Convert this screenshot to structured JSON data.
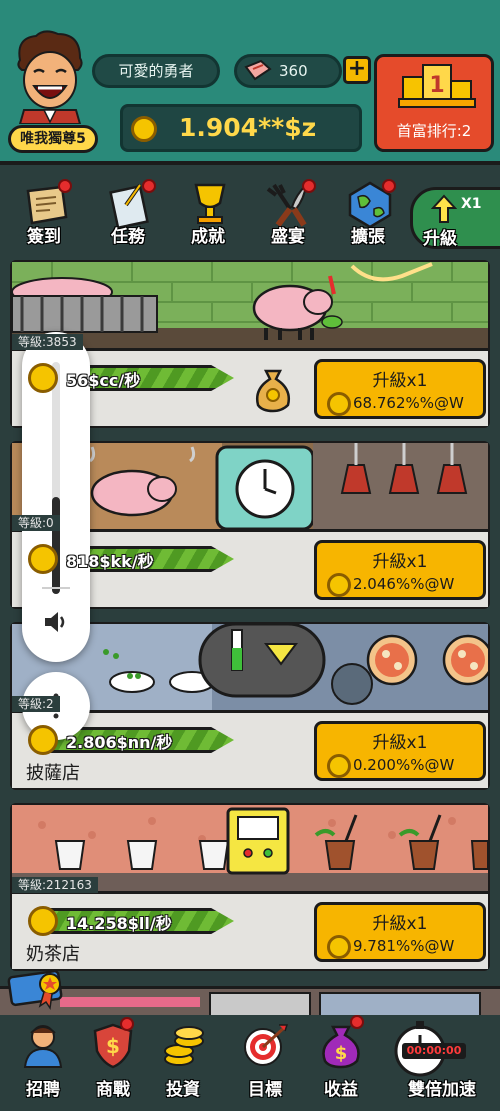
{
  "player": {
    "name": "可愛的勇者",
    "title_badge": "唯我獨尊5",
    "gems": "360",
    "money": "1.904**$z",
    "rank_label": "首富排行:2"
  },
  "menu": {
    "items": [
      {
        "label": "簽到",
        "icon": "scroll-icon",
        "has_dot": true
      },
      {
        "label": "任務",
        "icon": "clipboard-icon",
        "has_dot": true
      },
      {
        "label": "成就",
        "icon": "trophy-icon",
        "has_dot": false
      },
      {
        "label": "盛宴",
        "icon": "fork-knife-icon",
        "has_dot": true
      },
      {
        "label": "擴張",
        "icon": "globe-icon",
        "has_dot": true
      }
    ],
    "upgrade": {
      "label": "升級",
      "multiplier": "X1"
    }
  },
  "shops": [
    {
      "level": "等級:3853",
      "rate": "56$cc/秒",
      "upgrade_label": "升級x1",
      "upgrade_cost": "68.762%%@W",
      "name": ""
    },
    {
      "level": "等級:0",
      "rate": "818$kk/秒",
      "upgrade_label": "升級x1",
      "upgrade_cost": "2.046%%@W",
      "name": ""
    },
    {
      "level": "等級:2",
      "rate": "2.806$nn/秒",
      "upgrade_label": "升級x1",
      "upgrade_cost": "0.200%%@W",
      "name": "披薩店"
    },
    {
      "level": "等級:212163",
      "rate": "14.258$ll/秒",
      "upgrade_label": "升級x1",
      "upgrade_cost": "9.781%%@W",
      "name": "奶茶店"
    }
  ],
  "volume": {
    "level": 0.42
  },
  "bottom_nav": {
    "items": [
      {
        "label": "招聘",
        "icon": "person-icon"
      },
      {
        "label": "商戰",
        "icon": "shield-dollar-icon"
      },
      {
        "label": "投資",
        "icon": "coins-icon"
      },
      {
        "label": "目標",
        "icon": "target-icon"
      },
      {
        "label": "收益",
        "icon": "money-bag-icon"
      },
      {
        "label": "雙倍加速",
        "icon": "stopwatch-icon"
      }
    ],
    "timer": "00:00:00"
  },
  "colors": {
    "header_bg": "#2a8a7a",
    "button_gold": "#f7b500",
    "rank_red": "#e54b2b",
    "rate_green": "#6fbb35"
  }
}
